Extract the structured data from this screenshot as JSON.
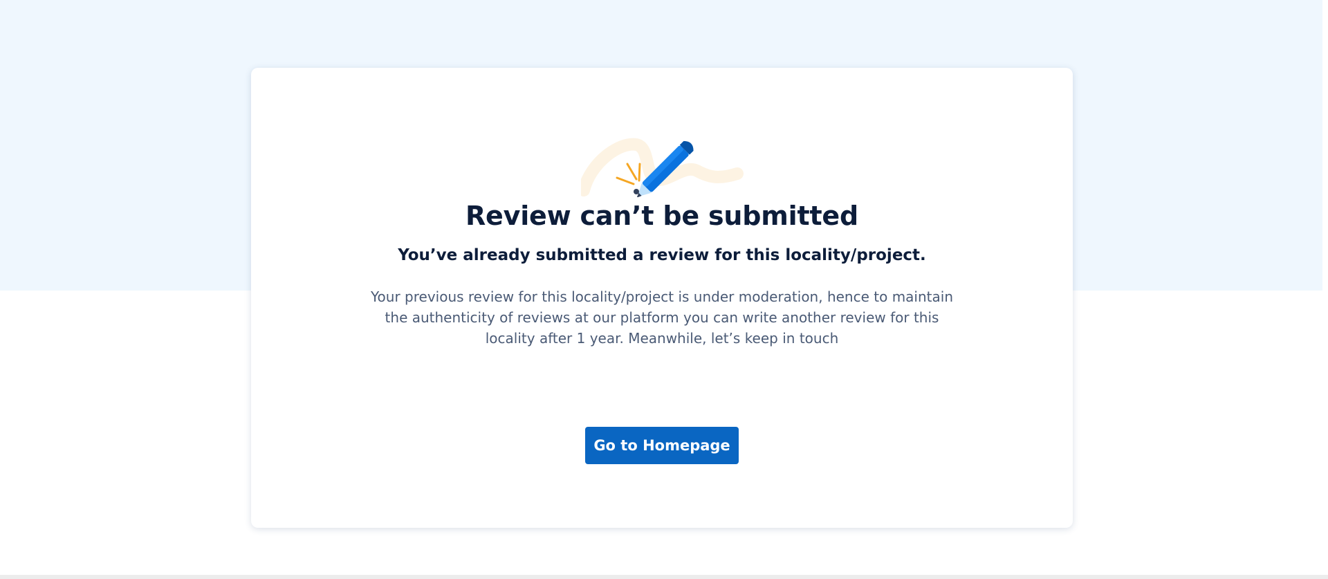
{
  "illustration": {
    "icon": "pencil-signature-icon"
  },
  "message": {
    "title": "Review can’t be submitted",
    "subtitle": "You’ve already submitted a review for this locality/project.",
    "body": "Your previous review for this locality/project is under moderation, hence to maintain the authenticity of reviews at our platform you can write another review for this locality after 1 year. Meanwhile, let’s keep in touch"
  },
  "actions": {
    "home_label": "Go to Homepage"
  },
  "colors": {
    "accent": "#0a66c2",
    "background_band": "#eff7fe",
    "title_text": "#0d1d3a",
    "body_text": "#4a5a75"
  }
}
